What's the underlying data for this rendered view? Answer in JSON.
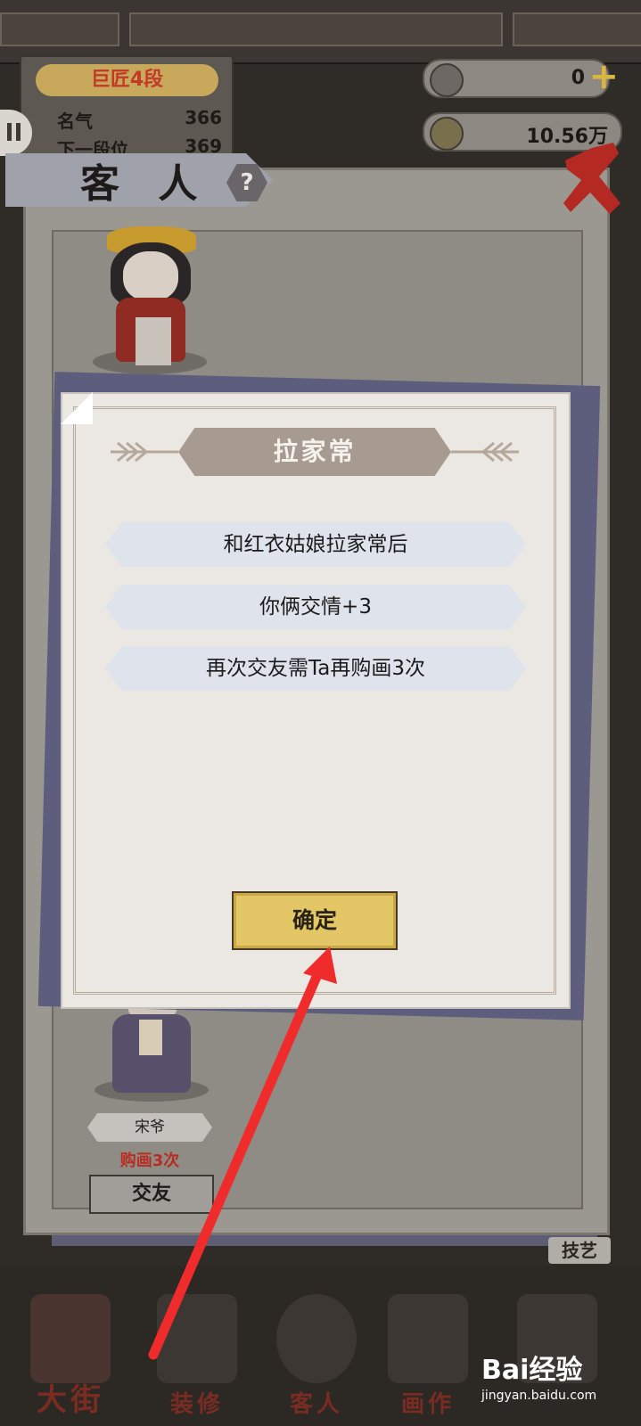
{
  "header": {
    "rank": "巨匠4段",
    "stats": [
      {
        "label": "名气",
        "value": "366"
      },
      {
        "label": "下一段位",
        "value": "369"
      }
    ],
    "resources": [
      {
        "icon": "jade-icon",
        "value": "0"
      },
      {
        "icon": "coin-icon",
        "value": "10.56万"
      }
    ]
  },
  "guest_panel": {
    "title": "客 人",
    "help_label": "?",
    "guest": {
      "name": "宋爷",
      "buy_count": "购画3次",
      "friend_button": "交友"
    }
  },
  "dialog": {
    "title": "拉家常",
    "lines": [
      "和红衣姑娘拉家常后",
      "你俩交情+3",
      "再次交友需Ta再购画3次"
    ],
    "confirm_label": "确定"
  },
  "side_tag": "技艺",
  "bottom_nav": [
    {
      "label": "大街"
    },
    {
      "label": "装修"
    },
    {
      "label": "客人"
    },
    {
      "label": "画作"
    },
    {
      "label": ""
    }
  ],
  "watermark": {
    "brand": "Bai经验",
    "url": "jingyan.baidu.com"
  },
  "colors": {
    "annotation_arrow": "#f02b2b",
    "confirm_button": "#e3c766",
    "rank_text": "#c23a2a",
    "buy_count_text": "#b82d22"
  }
}
